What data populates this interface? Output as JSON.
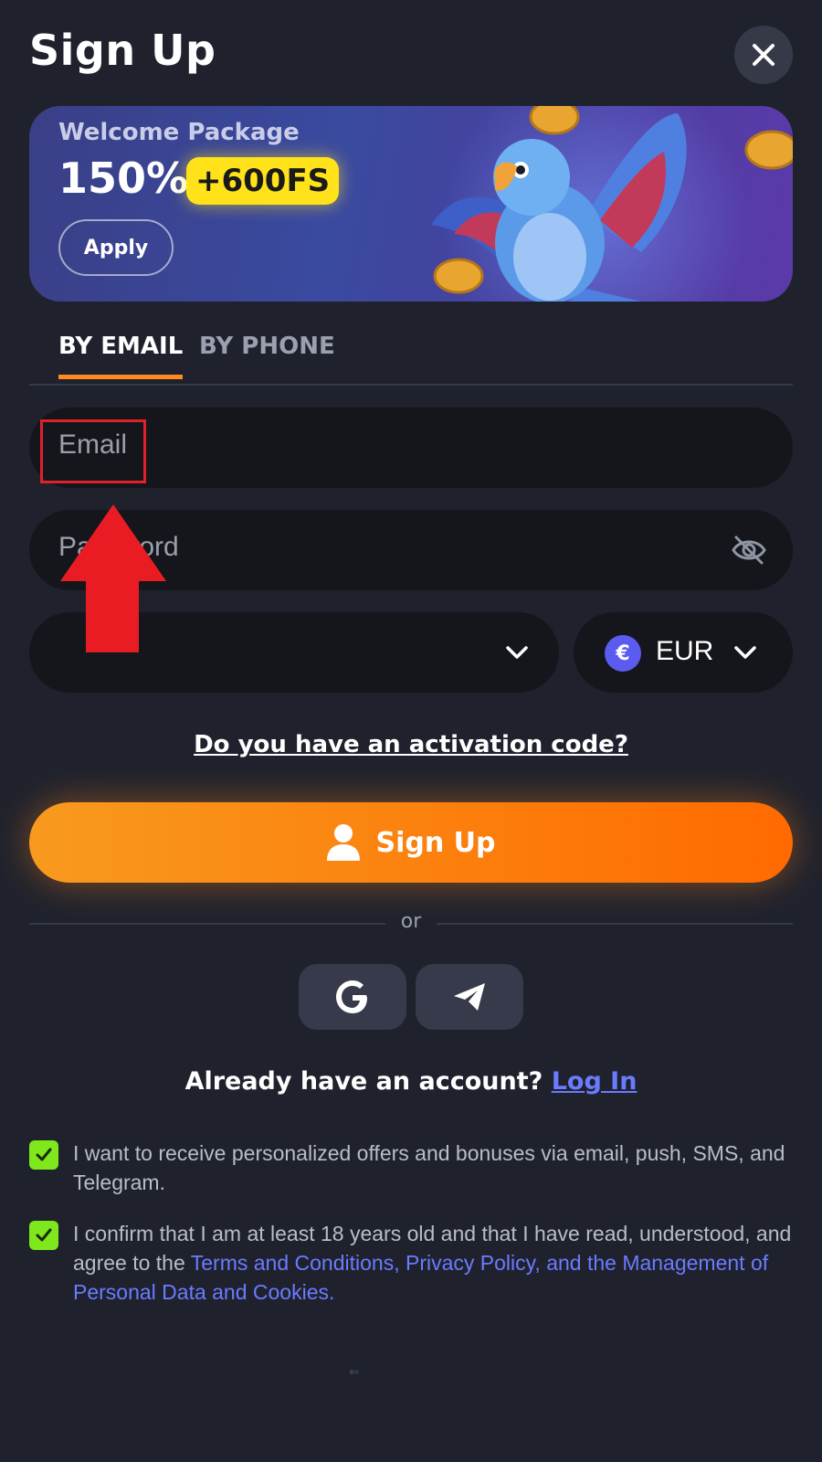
{
  "header": {
    "title": "Sign Up"
  },
  "banner": {
    "subtitle": "Welcome Package",
    "percent": "150%",
    "freespins": "+600FS",
    "apply_label": "Apply"
  },
  "tabs": [
    {
      "label": "BY EMAIL",
      "active": true
    },
    {
      "label": "BY PHONE",
      "active": false
    }
  ],
  "form": {
    "email_placeholder": "Email",
    "password_placeholder": "Password",
    "country_value": "",
    "currency_symbol": "€",
    "currency_code": "EUR",
    "activation_label": "Do you have an activation code?",
    "signup_label": "Sign Up"
  },
  "divider": {
    "text": "or"
  },
  "login": {
    "prompt": "Already have an account?",
    "link": "Log In"
  },
  "consents": [
    {
      "text": "I want to receive personalized offers and bonuses via email, push, SMS, and Telegram.",
      "checked": true
    },
    {
      "text": "I confirm that I am at least 18 years old and that I have read, understood, and agree to the ",
      "link": "Terms and Conditions, Privacy Policy, and the Management of Personal Data and Cookies.",
      "checked": true
    }
  ],
  "footer_mark": "⇐",
  "colors": {
    "accent_orange": "#ff8a1f",
    "link_blue": "#6b7bff",
    "check_green": "#7ee81c",
    "annotation_red": "#e0202a",
    "badge_yellow": "#ffe21a"
  }
}
